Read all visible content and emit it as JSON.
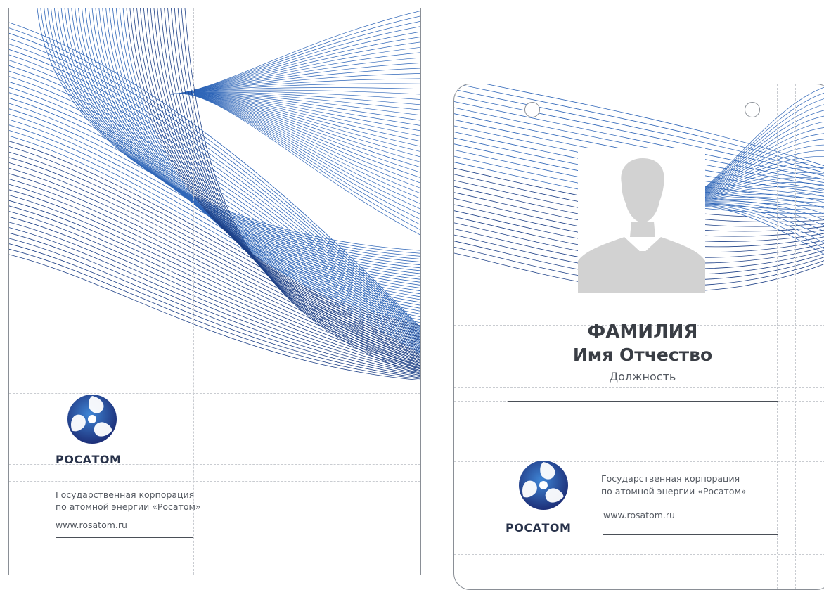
{
  "cover": {
    "brand": "РОСАТОМ",
    "org_line1": "Государственная корпорация",
    "org_line2": "по атомной энергии «Росатом»",
    "website": "www.rosatom.ru",
    "logo_icon": "rosatom-atom-logo-icon"
  },
  "badge": {
    "surname": "ФАМИЛИЯ",
    "given_names": "Имя Отчество",
    "position": "Должность",
    "brand": "РОСАТОМ",
    "org_line1": "Государственная корпорация",
    "org_line2": "по атомной энергии «Росатом»",
    "website": "www.rosatom.ru",
    "photo_icon": "person-silhouette-icon",
    "logo_icon": "rosatom-atom-logo-icon"
  },
  "colors": {
    "wave_blue": "#2f66b8",
    "wave_dark": "#1c3f86",
    "logo_blue": "#2561b0",
    "logo_navy": "#1d2f78",
    "text_dark": "#3a3e45",
    "guide": "#c9ccd1",
    "photo_grey": "#d2d2d2"
  }
}
